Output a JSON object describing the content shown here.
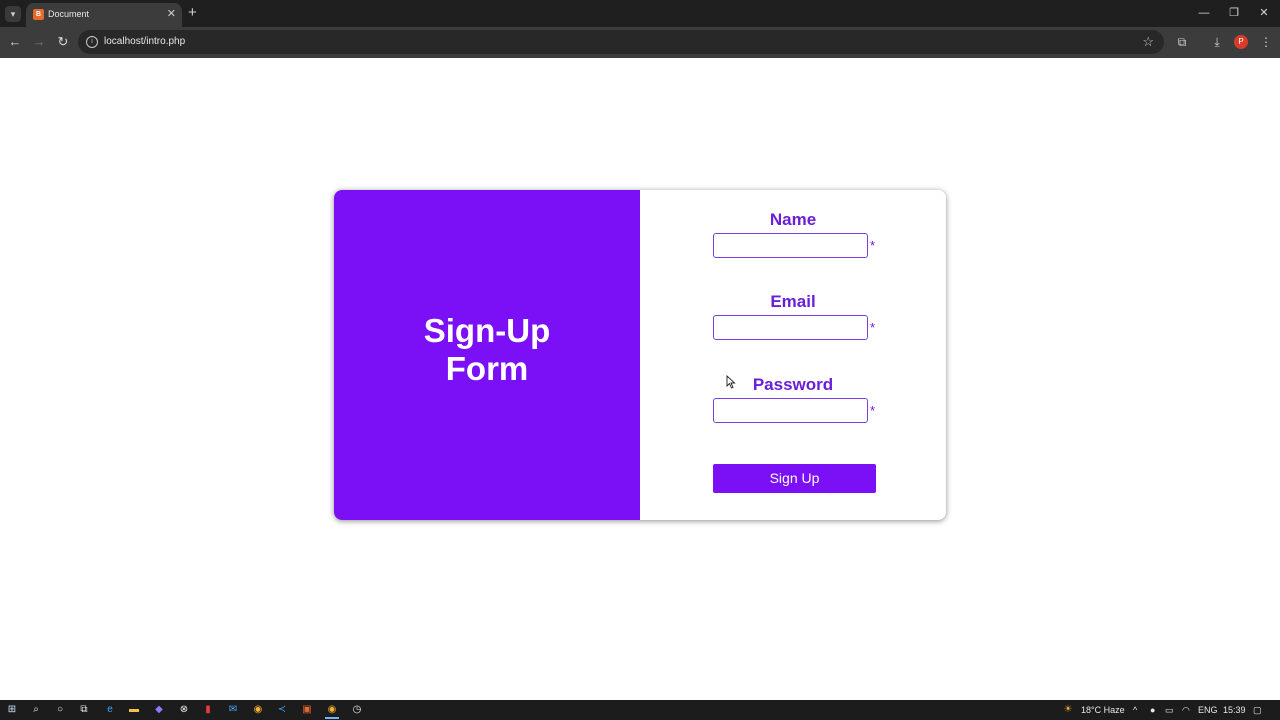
{
  "browser": {
    "tab_title": "Document",
    "tab_close_glyph": "✕",
    "new_tab_glyph": "+",
    "url": "localhost/intro.php",
    "profile_initial": "P",
    "window_controls": [
      "—",
      "❐",
      "✕"
    ]
  },
  "form": {
    "title_line1": "Sign-Up",
    "title_line2": "Form",
    "fields": [
      {
        "label": "Name",
        "value": "",
        "required_mark": "*"
      },
      {
        "label": "Email",
        "value": "",
        "required_mark": "*"
      },
      {
        "label": "Password",
        "value": "",
        "required_mark": "*"
      }
    ],
    "submit_label": "Sign Up"
  },
  "taskbar": {
    "weather": "18°C  Haze",
    "language": "ENG",
    "time": "15:39"
  },
  "colors": {
    "accent": "#7b10f7",
    "label": "#6a1ed8"
  }
}
